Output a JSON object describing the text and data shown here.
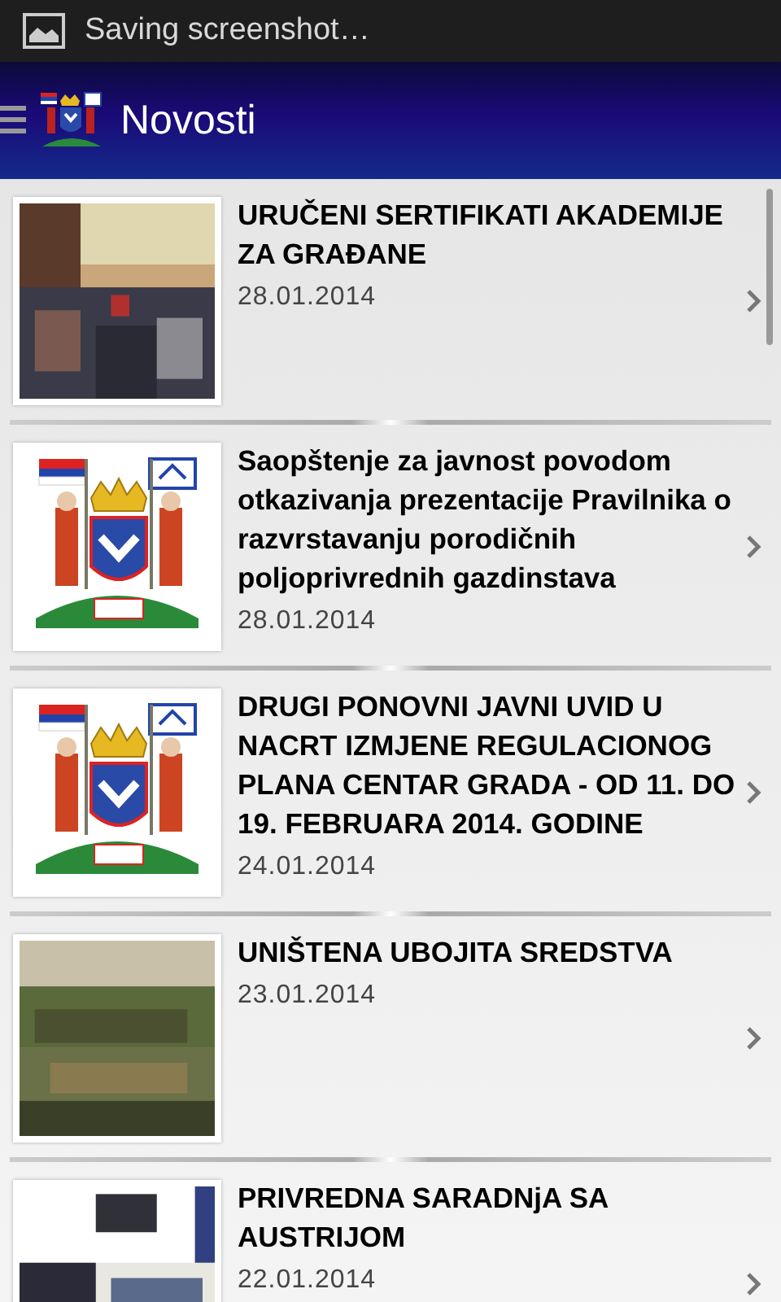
{
  "status_bar": {
    "notification": "Saving screenshot…"
  },
  "header": {
    "title": "Novosti"
  },
  "news": [
    {
      "title": "URUČENI SERTIFIKATI AKADEMIJE ZA GRAĐANE",
      "date": "28.01.2014"
    },
    {
      "thumbnail": {
        "kind": "emblem"
      },
      "title": "Saopštenje za javnost povodom otkazivanja prezentacije Pravilnika o razvrstavanju porodičnih poljoprivrednih gazdinstava",
      "date": "28.01.2014"
    },
    {
      "thumbnail": {
        "kind": "emblem"
      },
      "title": "DRUGI PONOVNI JAVNI UVID U NACRT IZMJENE REGULACIONOG PLANA CENTAR GRADA - OD 11. DO 19. FEBRUARA 2014. GODINE",
      "date": "24.01.2014"
    },
    {
      "title": "UNIŠTENA UBOJITA SREDSTVA",
      "date": "23.01.2014"
    },
    {
      "title": "PRIVREDNA SARADNjA SA AUSTRIJOM",
      "date": "22.01.2014"
    }
  ]
}
